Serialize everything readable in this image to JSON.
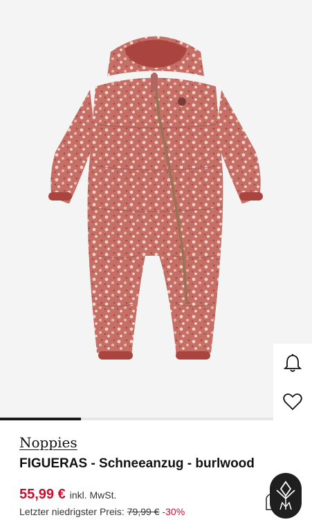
{
  "product": {
    "brand": "Noppies",
    "title": "FIGUERAS - Schneeanzug - burlwood",
    "price": "55,99 €",
    "vat_note": "inkl. MwSt.",
    "lowest_price_label": "Letzter niedrigster Preis:",
    "old_price": "79,99 €",
    "discount": "-30%"
  },
  "gallery": {
    "image_name": "snowsuit-burlwood",
    "progress_fraction": 0.26
  },
  "actions": {
    "bell": "bell-icon",
    "heart": "heart-icon",
    "assistant": "assistant-logo-icon"
  },
  "colors": {
    "price": "#c8102e",
    "suit": "#c66f67",
    "trim": "#a9443f"
  }
}
